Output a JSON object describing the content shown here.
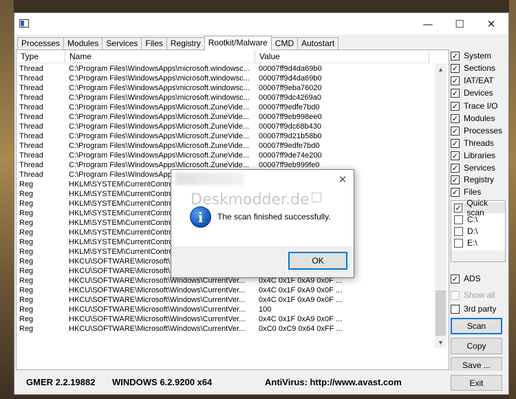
{
  "window": {
    "minimize_glyph": "—",
    "maximize_glyph": "☐",
    "close_glyph": "✕"
  },
  "tabs": [
    {
      "label": "Processes"
    },
    {
      "label": "Modules"
    },
    {
      "label": "Services"
    },
    {
      "label": "Files"
    },
    {
      "label": "Registry"
    },
    {
      "label": "Rootkit/Malware",
      "active": true
    },
    {
      "label": "CMD"
    },
    {
      "label": "Autostart"
    }
  ],
  "list": {
    "columns": [
      "Type",
      "Name",
      "Value"
    ],
    "rows": [
      [
        "Thread",
        "C:\\Program Files\\WindowsApps\\microsoft.windowsc...",
        "00007ff9d4da69b0"
      ],
      [
        "Thread",
        "C:\\Program Files\\WindowsApps\\microsoft.windowsc...",
        "00007ff9d4da69b0"
      ],
      [
        "Thread",
        "C:\\Program Files\\WindowsApps\\microsoft.windowsc...",
        "00007ff9eba76020"
      ],
      [
        "Thread",
        "C:\\Program Files\\WindowsApps\\microsoft.windowsc...",
        "00007ff9dc4269a0"
      ],
      [
        "Thread",
        "C:\\Program Files\\WindowsApps\\Microsoft.ZuneVide...",
        "00007ff9edfe7bd0"
      ],
      [
        "Thread",
        "C:\\Program Files\\WindowsApps\\Microsoft.ZuneVide...",
        "00007ff9eb998ee0"
      ],
      [
        "Thread",
        "C:\\Program Files\\WindowsApps\\Microsoft.ZuneVide...",
        "00007ff9dc68b430"
      ],
      [
        "Thread",
        "C:\\Program Files\\WindowsApps\\Microsoft.ZuneVide...",
        "00007ff9d21b58b0"
      ],
      [
        "Thread",
        "C:\\Program Files\\WindowsApps\\Microsoft.ZuneVide...",
        "00007ff9edfe7bd0"
      ],
      [
        "Thread",
        "C:\\Program Files\\WindowsApps\\Microsoft.ZuneVide...",
        "00007ff9de74e200"
      ],
      [
        "Thread",
        "C:\\Program Files\\WindowsApps\\Microsoft.ZuneVide...",
        "00007ff9eb999fe0"
      ],
      [
        "Thread",
        "C:\\Program Files\\WindowsApps\\",
        ""
      ],
      [
        "Reg",
        "HKLM\\SYSTEM\\CurrentContro",
        ""
      ],
      [
        "Reg",
        "HKLM\\SYSTEM\\CurrentContro",
        ""
      ],
      [
        "Reg",
        "HKLM\\SYSTEM\\CurrentContro",
        ""
      ],
      [
        "Reg",
        "HKLM\\SYSTEM\\CurrentContro",
        ""
      ],
      [
        "Reg",
        "HKLM\\SYSTEM\\CurrentContro",
        ""
      ],
      [
        "Reg",
        "HKLM\\SYSTEM\\CurrentContro",
        ""
      ],
      [
        "Reg",
        "HKLM\\SYSTEM\\CurrentContro",
        ""
      ],
      [
        "Reg",
        "HKLM\\SYSTEM\\CurrentContro",
        ""
      ],
      [
        "Reg",
        "HKCU\\SOFTWARE\\Microsoft\\",
        ""
      ],
      [
        "Reg",
        "HKCU\\SOFTWARE\\Microsoft\\",
        ""
      ],
      [
        "Reg",
        "HKCU\\SOFTWARE\\Microsoft\\Windows\\CurrentVer...",
        "0x4C 0x1F 0xA9 0x0F ..."
      ],
      [
        "Reg",
        "HKCU\\SOFTWARE\\Microsoft\\Windows\\CurrentVer...",
        "0x4C 0x1F 0xA9 0x0F ..."
      ],
      [
        "Reg",
        "HKCU\\SOFTWARE\\Microsoft\\Windows\\CurrentVer...",
        "0x4C 0x1F 0xA9 0x0F ..."
      ],
      [
        "Reg",
        "HKCU\\SOFTWARE\\Microsoft\\Windows\\CurrentVer...",
        "100"
      ],
      [
        "Reg",
        "HKCU\\SOFTWARE\\Microsoft\\Windows\\CurrentVer...",
        "0x4C 0x1F 0xA9 0x0F ..."
      ],
      [
        "Reg",
        "HKCU\\SOFTWARE\\Microsoft\\Windows\\CurrentVer...",
        "0xC0 0xC9 0x64 0xFF ..."
      ]
    ]
  },
  "options": {
    "system": {
      "label": "System",
      "checked": true
    },
    "sections": {
      "label": "Sections",
      "checked": true
    },
    "iat_eat": {
      "label": "IAT/EAT",
      "checked": true
    },
    "devices": {
      "label": "Devices",
      "checked": true
    },
    "trace_io": {
      "label": "Trace I/O",
      "checked": true
    },
    "modules": {
      "label": "Modules",
      "checked": true
    },
    "processes": {
      "label": "Processes",
      "checked": true
    },
    "threads": {
      "label": "Threads",
      "checked": true
    },
    "libraries": {
      "label": "Libraries",
      "checked": true
    },
    "services": {
      "label": "Services",
      "checked": true
    },
    "registry": {
      "label": "Registry",
      "checked": true
    },
    "files": {
      "label": "Files",
      "checked": true
    },
    "ads": {
      "label": "ADS",
      "checked": true
    },
    "show_all": {
      "label": "Show all",
      "checked": false
    },
    "third_party": {
      "label": "3rd party",
      "checked": false
    }
  },
  "drives": [
    {
      "label": "Quick scan",
      "checked": true
    },
    {
      "label": "C:\\",
      "checked": false
    },
    {
      "label": "D:\\",
      "checked": false
    },
    {
      "label": "E:\\",
      "checked": false
    }
  ],
  "buttons": {
    "scan": "Scan",
    "copy": "Copy",
    "save": "Save ...",
    "exit": "Exit"
  },
  "status": {
    "version": "GMER 2.2.19882",
    "os": "WINDOWS 6.2.9200  x64",
    "antivirus": "AntiVirus: http://www.avast.com"
  },
  "dialog": {
    "watermark": "Deskmodder.de",
    "message": "The scan finished successfully.",
    "ok_label": "OK",
    "close_glyph": "✕",
    "icon_glyph": "i"
  },
  "check_glyph": "✓",
  "colors": {
    "accent": "#0078d7",
    "info_icon": "#1d5fc4"
  }
}
